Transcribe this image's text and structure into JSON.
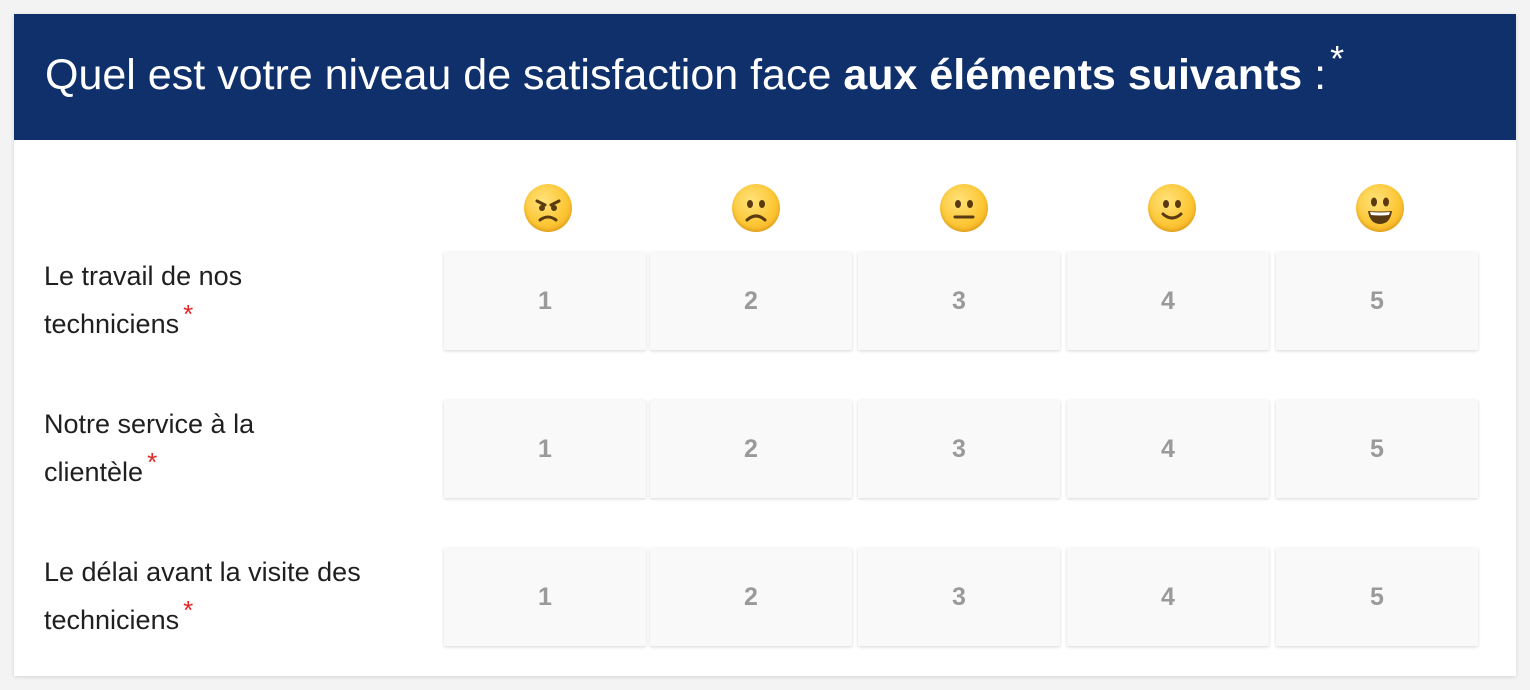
{
  "question": {
    "title_regular": "Quel est votre niveau de satisfaction face ",
    "title_bold": "aux éléments suivants",
    "title_suffix": " :",
    "required_mark": "*"
  },
  "scale_icons": [
    "angry-face-icon",
    "slightly-frowning-face-icon",
    "neutral-face-icon",
    "slightly-smiling-face-icon",
    "grinning-face-icon"
  ],
  "rows": [
    {
      "line1": "Le travail de nos",
      "line2": "techniciens",
      "required": "*",
      "options": [
        "1",
        "2",
        "3",
        "4",
        "5"
      ]
    },
    {
      "line1": "Notre service à la",
      "line2": "clientèle",
      "required": "*",
      "options": [
        "1",
        "2",
        "3",
        "4",
        "5"
      ]
    },
    {
      "line1": "Le délai avant la visite des",
      "line2": "techniciens",
      "required": "*",
      "options": [
        "1",
        "2",
        "3",
        "4",
        "5"
      ]
    }
  ],
  "colors": {
    "header_bg": "#0f306b",
    "required": "#e02424",
    "option_text": "#9a9a9a",
    "option_bg": "#f9f9f9"
  }
}
